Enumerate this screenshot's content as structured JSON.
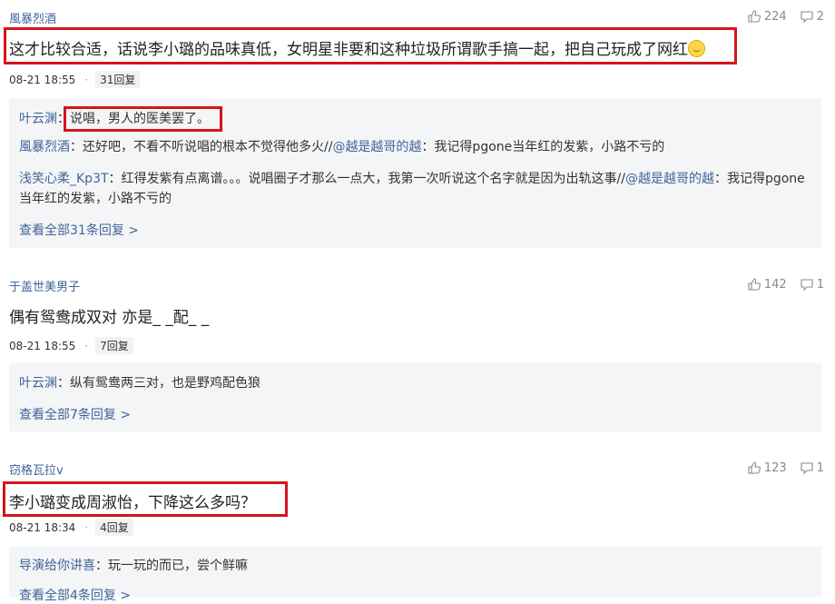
{
  "comments": [
    {
      "user": "風暴烈酒",
      "text": "这才比较合适，话说李小璐的品味真低，女明星非要和这种垃圾所谓歌手搞一起，把自己玩成了网红",
      "likes": "224",
      "reply_count_icon": "2",
      "time": "08-21 18:55",
      "reply_badge": "31回复",
      "replies": [
        {
          "name": "叶云渊",
          "sep": "：",
          "text": "说唱，男人的医美罢了。"
        },
        {
          "name": "風暴烈酒",
          "sep": "：",
          "text": "还好吧，不看不听说唱的根本不觉得他多火//",
          "at": "@越是越哥的越",
          "text2": "：我记得pgone当年红的发紫，小路不亏的"
        },
        {
          "name": "浅笑心柔_Kp3T",
          "sep": "：",
          "text": "红得发紫有点离谱。。。说唱圈子才那么一点大，我第一次听说这个名字就是因为出轨这事//",
          "at": "@越是越哥的越",
          "text2": "：我记得pgone当年红的发紫，小路不亏的"
        }
      ],
      "more": "查看全部31条回复 >"
    },
    {
      "user": "于盖世美男子",
      "text": "偶有鸳鸯成双对 亦是_ _配_ _",
      "likes": "142",
      "reply_count_icon": "1",
      "time": "08-21 18:55",
      "reply_badge": "7回复",
      "replies": [
        {
          "name": "叶云渊",
          "sep": "：",
          "text": "纵有鸳鸯两三对，也是野鸡配色狼"
        }
      ],
      "more": "查看全部7条回复 >"
    },
    {
      "user": "窃格瓦拉v",
      "text": "李小璐变成周淑怡，下降这么多吗？",
      "likes": "123",
      "reply_count_icon": "1",
      "time": "08-21 18:34",
      "reply_badge": "4回复",
      "replies": [
        {
          "name": "导演给你讲喜",
          "sep": "：",
          "text": "玩一玩的而已，尝个鲜嘛"
        }
      ],
      "more": "查看全部4条回复 >"
    }
  ],
  "colors": {
    "highlight": "#d4151c",
    "link": "#406599",
    "reply_bg": "#f4f5f7"
  },
  "icons": {
    "like": "thumbs-up-icon",
    "reply": "comment-bubble-icon"
  }
}
